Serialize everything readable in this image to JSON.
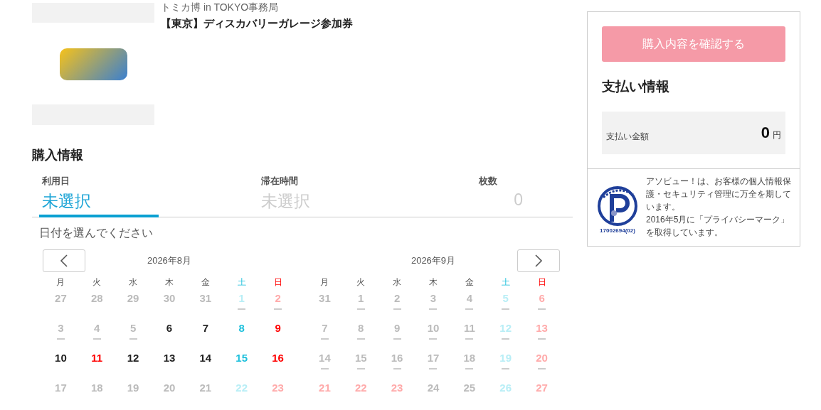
{
  "product": {
    "organizer": "トミカ博 in TOKYO事務局",
    "title": "【東京】ディスカバリーガレージ参加券"
  },
  "purchase": {
    "heading": "購入情報",
    "tabs": [
      {
        "label": "利用日",
        "value": "未選択",
        "selected": true
      },
      {
        "label": "滞在時間",
        "value": "未選択",
        "selected": false
      },
      {
        "label": "枚数",
        "value": "0",
        "selected": false
      }
    ],
    "hint": "日付を選んでください"
  },
  "calendar": {
    "months": [
      {
        "title": "2026年8月",
        "weekdays": [
          {
            "label": "月",
            "kind": "weekday"
          },
          {
            "label": "火",
            "kind": "weekday"
          },
          {
            "label": "水",
            "kind": "weekday"
          },
          {
            "label": "木",
            "kind": "weekday"
          },
          {
            "label": "金",
            "kind": "weekday"
          },
          {
            "label": "土",
            "kind": "saturday"
          },
          {
            "label": "日",
            "kind": "holiday"
          }
        ],
        "weeks": [
          [
            {
              "day": "27",
              "kind": "weekday",
              "available": false,
              "dash": false
            },
            {
              "day": "28",
              "kind": "weekday",
              "available": false,
              "dash": false
            },
            {
              "day": "29",
              "kind": "weekday",
              "available": false,
              "dash": false
            },
            {
              "day": "30",
              "kind": "weekday",
              "available": false,
              "dash": false
            },
            {
              "day": "31",
              "kind": "weekday",
              "available": false,
              "dash": false
            },
            {
              "day": "1",
              "kind": "saturday",
              "available": false,
              "dash": true
            },
            {
              "day": "2",
              "kind": "holiday",
              "available": false,
              "dash": true
            }
          ],
          [
            {
              "day": "3",
              "kind": "weekday",
              "available": false,
              "dash": true
            },
            {
              "day": "4",
              "kind": "weekday",
              "available": false,
              "dash": true
            },
            {
              "day": "5",
              "kind": "weekday",
              "available": false,
              "dash": true
            },
            {
              "day": "6",
              "kind": "weekday",
              "available": true,
              "dash": false
            },
            {
              "day": "7",
              "kind": "weekday",
              "available": true,
              "dash": false
            },
            {
              "day": "8",
              "kind": "saturday",
              "available": true,
              "dash": false
            },
            {
              "day": "9",
              "kind": "holiday",
              "available": true,
              "dash": false
            }
          ],
          [
            {
              "day": "10",
              "kind": "weekday",
              "available": true,
              "dash": false
            },
            {
              "day": "11",
              "kind": "holiday",
              "available": true,
              "dash": false
            },
            {
              "day": "12",
              "kind": "weekday",
              "available": true,
              "dash": false
            },
            {
              "day": "13",
              "kind": "weekday",
              "available": true,
              "dash": false
            },
            {
              "day": "14",
              "kind": "weekday",
              "available": true,
              "dash": false
            },
            {
              "day": "15",
              "kind": "saturday",
              "available": true,
              "dash": false
            },
            {
              "day": "16",
              "kind": "holiday",
              "available": true,
              "dash": false
            }
          ],
          [
            {
              "day": "17",
              "kind": "weekday",
              "available": false,
              "dash": false
            },
            {
              "day": "18",
              "kind": "weekday",
              "available": false,
              "dash": false
            },
            {
              "day": "19",
              "kind": "weekday",
              "available": false,
              "dash": false
            },
            {
              "day": "20",
              "kind": "weekday",
              "available": false,
              "dash": false
            },
            {
              "day": "21",
              "kind": "weekday",
              "available": false,
              "dash": false
            },
            {
              "day": "22",
              "kind": "saturday",
              "available": false,
              "dash": false
            },
            {
              "day": "23",
              "kind": "holiday",
              "available": false,
              "dash": false
            }
          ]
        ]
      },
      {
        "title": "2026年9月",
        "weekdays": [
          {
            "label": "月",
            "kind": "weekday"
          },
          {
            "label": "火",
            "kind": "weekday"
          },
          {
            "label": "水",
            "kind": "weekday"
          },
          {
            "label": "木",
            "kind": "weekday"
          },
          {
            "label": "金",
            "kind": "weekday"
          },
          {
            "label": "土",
            "kind": "saturday"
          },
          {
            "label": "日",
            "kind": "holiday"
          }
        ],
        "weeks": [
          [
            {
              "day": "31",
              "kind": "weekday",
              "available": false,
              "dash": false
            },
            {
              "day": "1",
              "kind": "weekday",
              "available": false,
              "dash": true
            },
            {
              "day": "2",
              "kind": "weekday",
              "available": false,
              "dash": true
            },
            {
              "day": "3",
              "kind": "weekday",
              "available": false,
              "dash": true
            },
            {
              "day": "4",
              "kind": "weekday",
              "available": false,
              "dash": true
            },
            {
              "day": "5",
              "kind": "saturday",
              "available": false,
              "dash": true
            },
            {
              "day": "6",
              "kind": "holiday",
              "available": false,
              "dash": true
            }
          ],
          [
            {
              "day": "7",
              "kind": "weekday",
              "available": false,
              "dash": true
            },
            {
              "day": "8",
              "kind": "weekday",
              "available": false,
              "dash": true
            },
            {
              "day": "9",
              "kind": "weekday",
              "available": false,
              "dash": true
            },
            {
              "day": "10",
              "kind": "weekday",
              "available": false,
              "dash": true
            },
            {
              "day": "11",
              "kind": "weekday",
              "available": false,
              "dash": true
            },
            {
              "day": "12",
              "kind": "saturday",
              "available": false,
              "dash": true
            },
            {
              "day": "13",
              "kind": "holiday",
              "available": false,
              "dash": true
            }
          ],
          [
            {
              "day": "14",
              "kind": "weekday",
              "available": false,
              "dash": true
            },
            {
              "day": "15",
              "kind": "weekday",
              "available": false,
              "dash": true
            },
            {
              "day": "16",
              "kind": "weekday",
              "available": false,
              "dash": true
            },
            {
              "day": "17",
              "kind": "weekday",
              "available": false,
              "dash": true
            },
            {
              "day": "18",
              "kind": "weekday",
              "available": false,
              "dash": true
            },
            {
              "day": "19",
              "kind": "saturday",
              "available": false,
              "dash": true
            },
            {
              "day": "20",
              "kind": "holiday",
              "available": false,
              "dash": true
            }
          ],
          [
            {
              "day": "21",
              "kind": "holiday",
              "available": false,
              "dash": false
            },
            {
              "day": "22",
              "kind": "holiday",
              "available": false,
              "dash": false
            },
            {
              "day": "23",
              "kind": "holiday",
              "available": false,
              "dash": false
            },
            {
              "day": "24",
              "kind": "weekday",
              "available": false,
              "dash": false
            },
            {
              "day": "25",
              "kind": "weekday",
              "available": false,
              "dash": false
            },
            {
              "day": "26",
              "kind": "saturday",
              "available": false,
              "dash": false
            },
            {
              "day": "27",
              "kind": "holiday",
              "available": false,
              "dash": false
            }
          ]
        ]
      }
    ]
  },
  "summary": {
    "confirm_button": {
      "label": "購入内容を確認する",
      "disabled": true
    },
    "heading": "支払い情報",
    "amount_label": "支払い金額",
    "amount": "0",
    "currency": "円"
  },
  "privacy": {
    "mark_number": "17002694(02)",
    "text": "アソビュー！は、お客様の個人情報保護・セキュリティ管理に万全を期しています。",
    "text_2": "2016年5月に「プライバシーマーク」を取得しています。"
  }
}
